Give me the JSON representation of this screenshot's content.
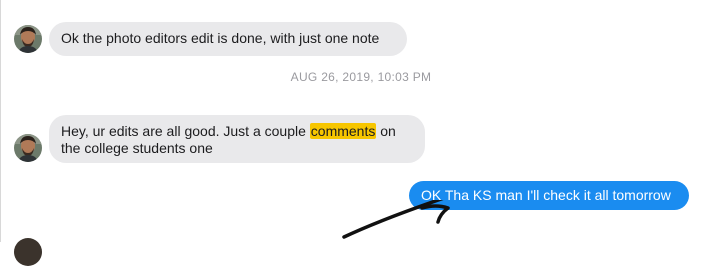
{
  "messages": [
    {
      "id": "m1",
      "direction": "incoming",
      "text": "Ok the photo editors edit is done, with just one note"
    },
    {
      "id": "m2",
      "direction": "incoming",
      "text_before": "Hey, ur edits are all good. Just a couple ",
      "highlighted": "comments",
      "text_after_line1": " on",
      "text_line2": "the college students one"
    },
    {
      "id": "m3",
      "direction": "outgoing",
      "text": "OK Tha KS man I'll check it all tomorrow"
    }
  ],
  "timestamp": "AUG 26, 2019, 10:03 PM",
  "colors": {
    "incoming_bubble": "#e9e9eb",
    "outgoing_bubble": "#1a8cf0",
    "highlight": "#f7c600",
    "timestamp": "#9a9a9f"
  },
  "icons": {
    "avatar": "contact-avatar-photo",
    "annotation": "hand-drawn-arrow"
  }
}
